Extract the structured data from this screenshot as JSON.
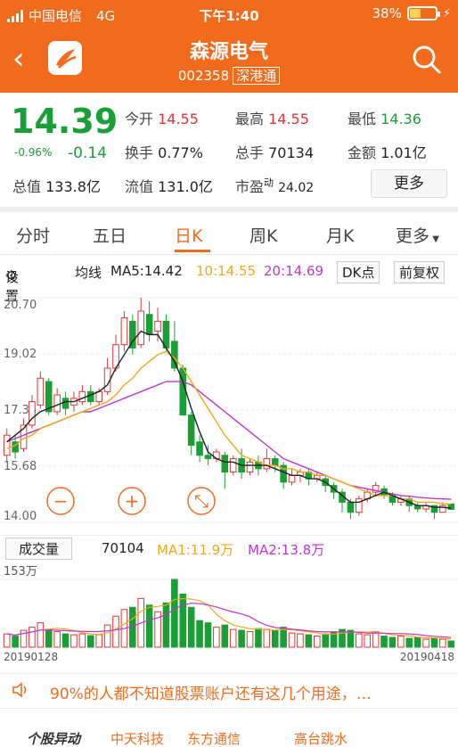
{
  "status": {
    "carrier": "中国电信",
    "network": "4G",
    "time": "下午1:40",
    "battery": "38%"
  },
  "nav": {
    "back": "‹",
    "title": "森源电气",
    "code": "002358",
    "tag": "深港通"
  },
  "quote": {
    "price": "14.39",
    "change_pct": "-0.96%",
    "change": "-0.14",
    "open_label": "今开",
    "open": "14.55",
    "high_label": "最高",
    "high": "14.55",
    "low_label": "最低",
    "low": "14.36",
    "turnover_label": "换手",
    "turnover": "0.77%",
    "volume_label": "总手",
    "volume": "70134",
    "amount_label": "金额",
    "amount": "1.01亿",
    "mktcap_label": "总值",
    "mktcap": "133.8亿",
    "float_label": "流值",
    "float": "131.0亿",
    "pe_label": "市盈",
    "pe_sup": "动",
    "pe": "24.02",
    "more": "更多"
  },
  "tabs": [
    "分时",
    "五日",
    "日K",
    "周K",
    "月K",
    "更多"
  ],
  "ma_bar": {
    "settings": "设置",
    "ma_label": "均线",
    "ma5": "MA5:14.42",
    "ma10": "10:14.55",
    "ma20": "20:14.69",
    "dk": "DK点",
    "adjust": "前复权"
  },
  "axis": {
    "y_top": "20.70",
    "y_2": "19.02",
    "y_3": "17.35",
    "y_4": "15.68",
    "y_bottom": "14.00"
  },
  "volume_bar": {
    "title": "成交量",
    "value": "70104",
    "ma1": "MA1:11.9万",
    "ma2": "MA2:13.8万",
    "vol_max": "153万"
  },
  "dates": {
    "start": "20190128",
    "end": "20190418"
  },
  "news": "90%的人都不知道股票账户还有这几个用途，…",
  "bottom_items": [
    "个股异动",
    "中天科技",
    "东方通信",
    "高台跳水"
  ],
  "colors": {
    "brand": "#f26b1d",
    "up": "#e03535",
    "down": "#1a9e36",
    "ma5": "#222222",
    "ma10": "#f0a818",
    "ma20": "#c035d0"
  },
  "chart_data": {
    "type": "candlestick",
    "ylim": [
      14.0,
      20.7
    ],
    "candles": [
      [
        16.0,
        16.6,
        15.8,
        16.8
      ],
      [
        16.4,
        16.1,
        15.9,
        16.6
      ],
      [
        16.2,
        16.9,
        16.1,
        17.1
      ],
      [
        16.9,
        17.6,
        16.8,
        17.8
      ],
      [
        17.5,
        18.3,
        17.4,
        18.5
      ],
      [
        18.2,
        17.3,
        17.2,
        18.3
      ],
      [
        17.3,
        17.8,
        17.2,
        18.0
      ],
      [
        17.7,
        17.4,
        17.2,
        17.9
      ],
      [
        17.5,
        17.7,
        17.3,
        17.9
      ],
      [
        17.6,
        17.9,
        17.5,
        18.1
      ],
      [
        17.9,
        17.6,
        17.5,
        18.1
      ],
      [
        17.6,
        17.9,
        17.5,
        18.0
      ],
      [
        17.9,
        18.6,
        17.8,
        18.9
      ],
      [
        18.6,
        19.3,
        18.5,
        19.6
      ],
      [
        19.3,
        20.1,
        19.1,
        20.3
      ],
      [
        20.0,
        19.2,
        19.0,
        20.2
      ],
      [
        19.3,
        20.3,
        19.2,
        20.7
      ],
      [
        20.2,
        19.6,
        19.4,
        20.6
      ],
      [
        19.7,
        20.0,
        19.4,
        20.4
      ],
      [
        20.0,
        19.2,
        19.1,
        20.2
      ],
      [
        19.4,
        18.6,
        18.5,
        20.0
      ],
      [
        18.6,
        17.2,
        17.2,
        18.7
      ],
      [
        17.2,
        16.3,
        16.0,
        17.3
      ],
      [
        16.4,
        16.0,
        15.8,
        16.6
      ],
      [
        16.0,
        15.9,
        15.7,
        16.3
      ],
      [
        15.9,
        16.1,
        15.8,
        16.2
      ],
      [
        16.0,
        15.5,
        15.0,
        16.1
      ],
      [
        15.5,
        15.9,
        15.4,
        16.0
      ],
      [
        15.9,
        15.5,
        15.3,
        16.2
      ],
      [
        15.5,
        15.8,
        15.4,
        15.9
      ],
      [
        15.8,
        15.6,
        15.4,
        16.0
      ],
      [
        15.6,
        15.9,
        15.5,
        16.2
      ],
      [
        15.9,
        15.7,
        15.5,
        16.0
      ],
      [
        15.7,
        15.2,
        15.0,
        15.8
      ],
      [
        15.2,
        15.4,
        15.1,
        15.6
      ],
      [
        15.4,
        15.5,
        15.2,
        15.6
      ],
      [
        15.5,
        15.3,
        15.1,
        15.6
      ],
      [
        15.3,
        15.4,
        15.2,
        15.5
      ],
      [
        15.3,
        15.1,
        14.9,
        15.4
      ],
      [
        15.1,
        14.9,
        14.7,
        15.2
      ],
      [
        14.9,
        14.6,
        14.3,
        15.0
      ],
      [
        14.6,
        14.3,
        14.1,
        14.7
      ],
      [
        14.3,
        14.7,
        14.2,
        14.8
      ],
      [
        14.7,
        14.9,
        14.6,
        15.0
      ],
      [
        14.9,
        15.1,
        14.8,
        15.2
      ],
      [
        15.0,
        14.8,
        14.7,
        15.1
      ],
      [
        14.8,
        14.6,
        14.5,
        14.9
      ],
      [
        14.6,
        14.7,
        14.5,
        14.8
      ],
      [
        14.7,
        14.5,
        14.3,
        14.8
      ],
      [
        14.5,
        14.4,
        14.3,
        14.6
      ],
      [
        14.4,
        14.5,
        14.3,
        14.6
      ],
      [
        14.5,
        14.3,
        14.1,
        14.5
      ],
      [
        14.3,
        14.5,
        14.3,
        14.6
      ],
      [
        14.55,
        14.39,
        14.36,
        14.55
      ]
    ],
    "ma5": [
      16.4,
      16.6,
      16.8,
      17.1,
      17.3,
      17.4,
      17.5,
      17.6,
      17.6,
      17.7,
      17.8,
      17.9,
      18.1,
      18.6,
      19.0,
      19.4,
      19.7,
      19.6,
      19.6,
      19.2,
      18.8,
      18.2,
      17.4,
      16.7,
      16.1,
      15.9,
      15.8,
      15.8,
      15.7,
      15.7,
      15.7,
      15.7,
      15.6,
      15.5,
      15.4,
      15.4,
      15.3,
      15.3,
      15.2,
      15.0,
      14.8,
      14.6,
      14.6,
      14.7,
      14.8,
      14.9,
      14.8,
      14.7,
      14.6,
      14.5,
      14.5,
      14.45,
      14.45,
      14.42
    ],
    "ma10": [
      16.2,
      16.3,
      16.5,
      16.6,
      16.8,
      16.9,
      17.0,
      17.1,
      17.2,
      17.3,
      17.4,
      17.5,
      17.6,
      17.8,
      18.1,
      18.3,
      18.6,
      18.8,
      19.0,
      19.1,
      18.9,
      18.6,
      18.2,
      17.8,
      17.4,
      17.0,
      16.6,
      16.3,
      16.0,
      15.9,
      15.8,
      15.7,
      15.7,
      15.6,
      15.6,
      15.5,
      15.5,
      15.4,
      15.4,
      15.3,
      15.2,
      15.1,
      15.0,
      14.9,
      14.8,
      14.8,
      14.8,
      14.7,
      14.7,
      14.6,
      14.6,
      14.6,
      14.55,
      14.55
    ],
    "ma20": [
      16.4,
      16.5,
      16.6,
      16.7,
      16.8,
      16.9,
      17.0,
      17.1,
      17.2,
      17.3,
      17.3,
      17.4,
      17.5,
      17.6,
      17.7,
      17.8,
      17.9,
      18.0,
      18.1,
      18.2,
      18.2,
      18.2,
      18.1,
      17.9,
      17.7,
      17.5,
      17.3,
      17.1,
      16.9,
      16.7,
      16.5,
      16.3,
      16.1,
      15.9,
      15.8,
      15.7,
      15.6,
      15.5,
      15.4,
      15.3,
      15.2,
      15.1,
      15.05,
      15.0,
      14.95,
      14.9,
      14.85,
      14.8,
      14.78,
      14.75,
      14.73,
      14.71,
      14.7,
      14.69
    ],
    "volume": [
      30,
      25,
      38,
      45,
      55,
      40,
      35,
      30,
      28,
      30,
      26,
      28,
      50,
      70,
      85,
      90,
      110,
      95,
      80,
      100,
      153,
      120,
      90,
      60,
      55,
      45,
      50,
      40,
      38,
      35,
      42,
      40,
      38,
      45,
      32,
      30,
      28,
      25,
      30,
      35,
      40,
      38,
      30,
      28,
      35,
      25,
      22,
      25,
      20,
      22,
      18,
      20,
      18,
      14
    ],
    "vol_ylim": [
      0,
      153
    ]
  }
}
